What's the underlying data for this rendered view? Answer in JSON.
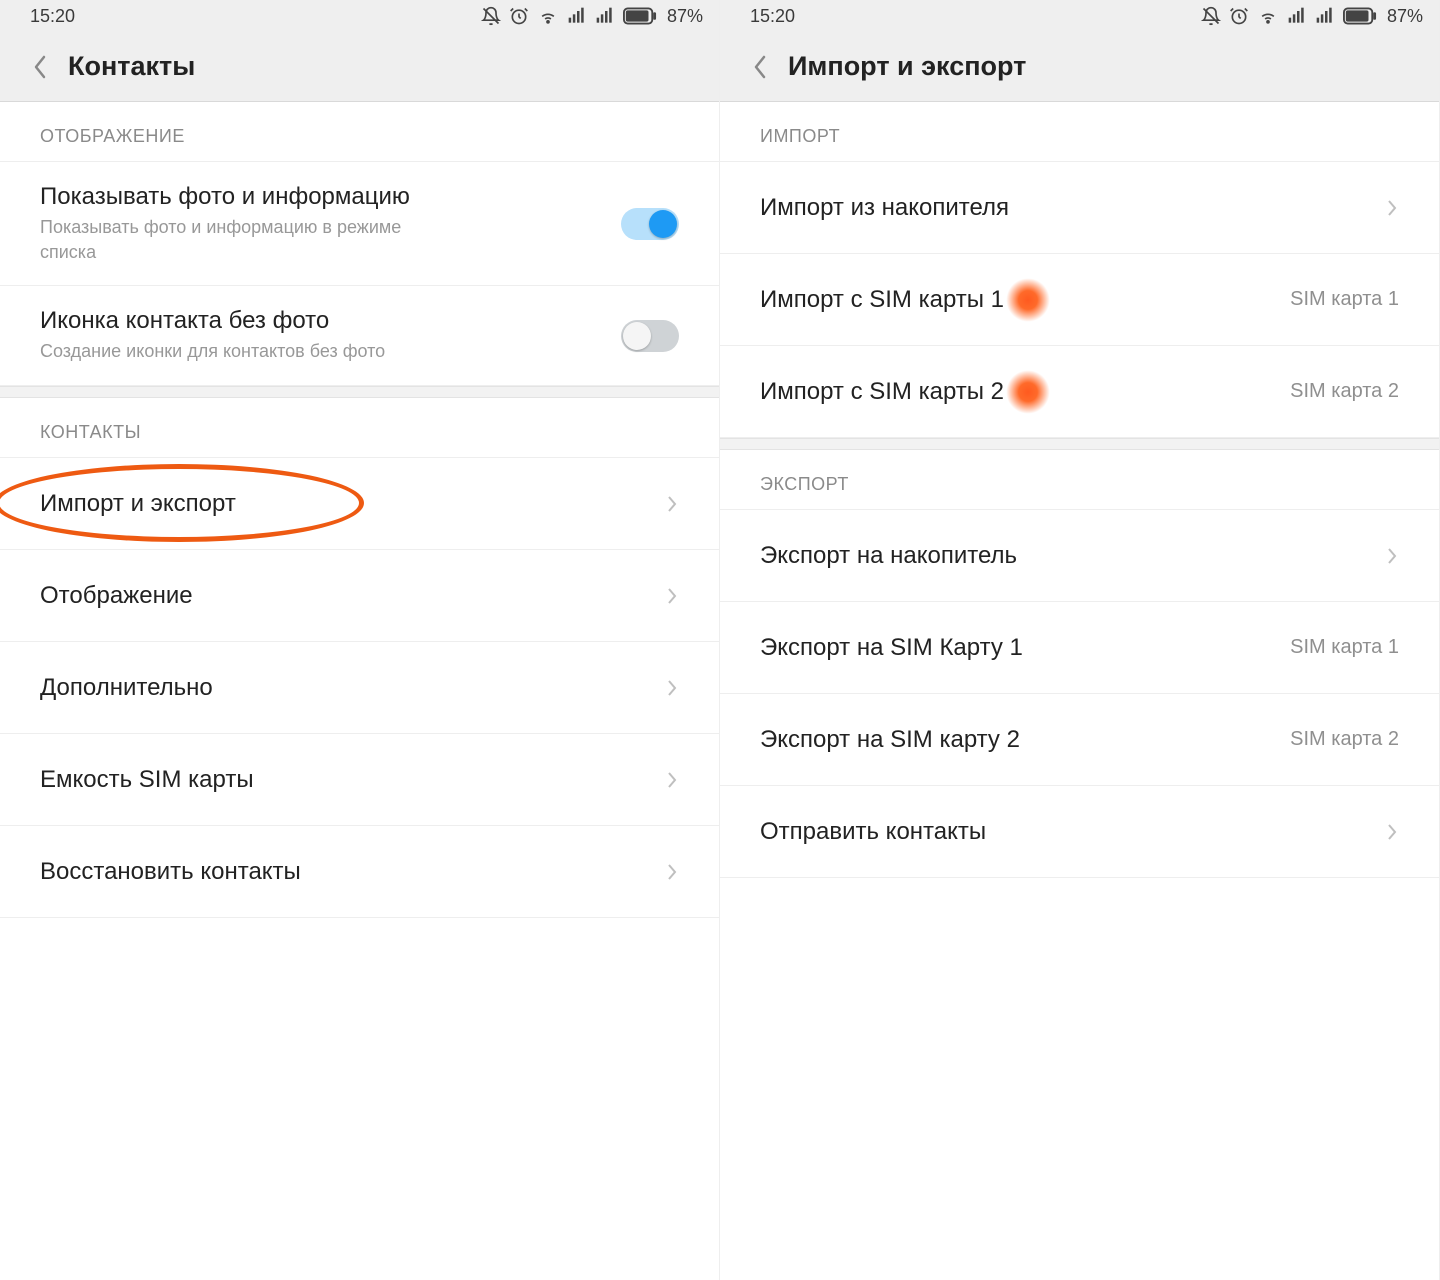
{
  "status": {
    "time": "15:20",
    "battery": "87%"
  },
  "left": {
    "title": "Контакты",
    "section1": "ОТОБРАЖЕНИЕ",
    "rowPhoto": {
      "title": "Показывать фото и информацию",
      "sub": "Показывать фото и информацию в режиме списка"
    },
    "rowIcon": {
      "title": "Иконка контакта без фото",
      "sub": "Создание иконки для контактов без фото"
    },
    "section2": "КОНТАКТЫ",
    "rows": {
      "importExport": "Импорт и экспорт",
      "display": "Отображение",
      "advanced": "Дополнительно",
      "simCapacity": "Емкость SIM карты",
      "restore": "Восстановить контакты"
    }
  },
  "right": {
    "title": "Импорт и экспорт",
    "sectionImport": "ИМПОРТ",
    "importStorage": "Импорт из накопителя",
    "importSim1": {
      "title": "Импорт с SIM карты 1",
      "value": "SIM карта 1"
    },
    "importSim2": {
      "title": "Импорт с SIM карты 2",
      "value": "SIM карта 2"
    },
    "sectionExport": "ЭКСПОРТ",
    "exportStorage": "Экспорт на накопитель",
    "exportSim1": {
      "title": "Экспорт на SIM Карту 1",
      "value": "SIM карта 1"
    },
    "exportSim2": {
      "title": "Экспорт на SIM карту 2",
      "value": "SIM карта 2"
    },
    "send": "Отправить контакты"
  }
}
